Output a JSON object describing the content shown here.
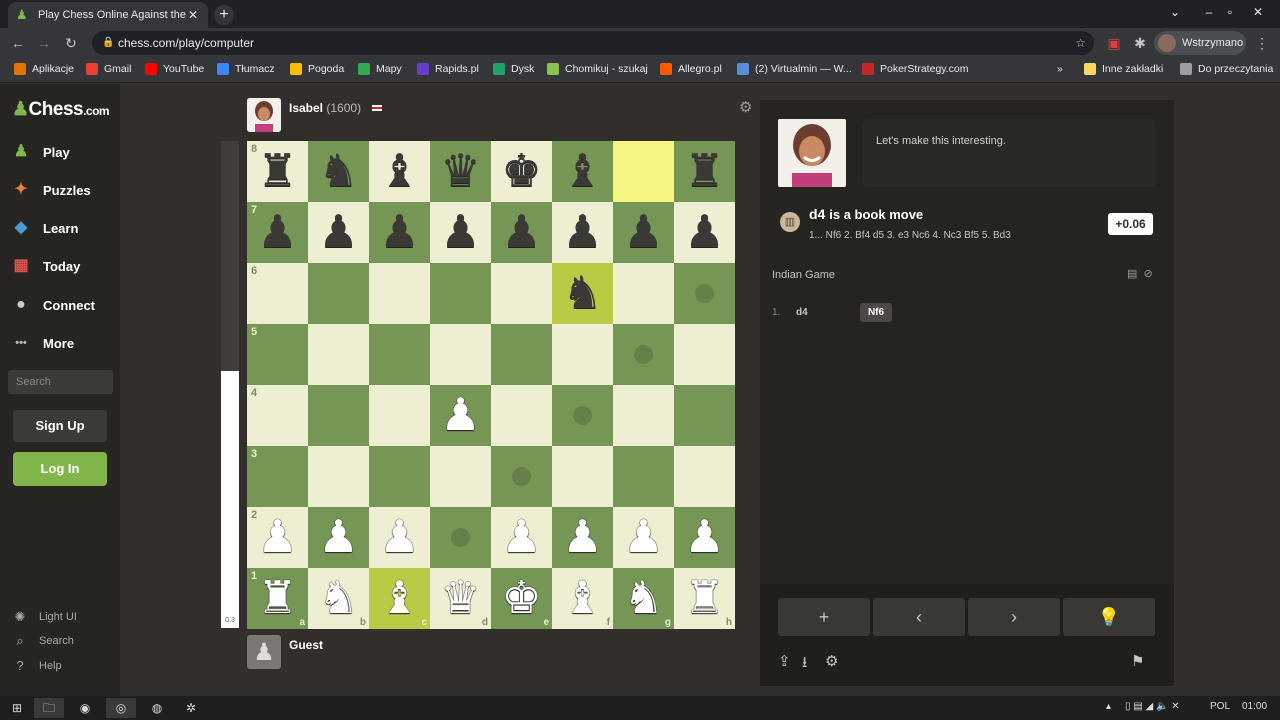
{
  "browser": {
    "tab_title": "Play Chess Online Against the Co",
    "url": "chess.com/play/computer",
    "profile_label": "Wstrzymano",
    "bookmarks": [
      {
        "label": "Aplikacje",
        "color": "#e37400"
      },
      {
        "label": "Gmail",
        "color": "#ea4335"
      },
      {
        "label": "YouTube",
        "color": "#ff0000"
      },
      {
        "label": "Tłumacz",
        "color": "#4285f4"
      },
      {
        "label": "Pogoda",
        "color": "#fbbc04"
      },
      {
        "label": "Mapy",
        "color": "#34a853"
      },
      {
        "label": "Rapids.pl",
        "color": "#6a3ec7"
      },
      {
        "label": "Dysk",
        "color": "#1fa463"
      },
      {
        "label": "Chomikuj - szukaj",
        "color": "#8bc34a"
      },
      {
        "label": "Allegro.pl",
        "color": "#ff5a00"
      },
      {
        "label": "(2) Virtualmin — W...",
        "color": "#5b8dd6"
      },
      {
        "label": "PokerStrategy.com",
        "color": "#c62828"
      },
      {
        "label": "Inne zakładki",
        "color": "#f9d65c"
      },
      {
        "label": "Do przeczytania",
        "color": "#9e9e9e"
      }
    ]
  },
  "sidebar": {
    "logo_main": "Chess",
    "logo_suffix": ".com",
    "items": [
      {
        "label": "Play",
        "icon": "hand-pawn-icon"
      },
      {
        "label": "Puzzles",
        "icon": "puzzle-icon"
      },
      {
        "label": "Learn",
        "icon": "learn-icon"
      },
      {
        "label": "Today",
        "icon": "news-icon"
      },
      {
        "label": "Connect",
        "icon": "chat-icon"
      },
      {
        "label": "More",
        "icon": "more-icon"
      }
    ],
    "search_placeholder": "Search",
    "signup_label": "Sign Up",
    "login_label": "Log In",
    "footer": [
      {
        "label": "Light UI",
        "icon": "sun-icon"
      },
      {
        "label": "Search",
        "icon": "search-icon"
      },
      {
        "label": "Help",
        "icon": "help-icon"
      }
    ]
  },
  "game": {
    "opponent_name": "Isabel",
    "opponent_rating": "(1600)",
    "player_name": "Guest",
    "eval_bar_value": "0.3",
    "board": [
      [
        "r",
        "n",
        "b",
        "q",
        "k",
        "b",
        "",
        "r"
      ],
      [
        "p",
        "p",
        "p",
        "p",
        "p",
        "p",
        "p",
        "p"
      ],
      [
        "",
        "",
        "",
        "",
        "",
        "n",
        "",
        ""
      ],
      [
        "",
        "",
        "",
        "",
        "",
        "",
        "",
        ""
      ],
      [
        "",
        "",
        "",
        "P",
        "",
        "",
        "",
        ""
      ],
      [
        "",
        "",
        "",
        "",
        "",
        "",
        "",
        ""
      ],
      [
        "P",
        "P",
        "P",
        "",
        "P",
        "P",
        "P",
        "P"
      ],
      [
        "R",
        "N",
        "B",
        "Q",
        "K",
        "B",
        "N",
        "R"
      ]
    ],
    "highlights": [
      {
        "r": 0,
        "c": 6
      },
      {
        "r": 2,
        "c": 5
      },
      {
        "r": 7,
        "c": 2
      }
    ],
    "hints": [
      {
        "r": 2,
        "c": 7
      },
      {
        "r": 3,
        "c": 6
      },
      {
        "r": 4,
        "c": 5
      },
      {
        "r": 5,
        "c": 4
      },
      {
        "r": 6,
        "c": 3
      }
    ],
    "files": [
      "a",
      "b",
      "c",
      "d",
      "e",
      "f",
      "g",
      "h"
    ],
    "ranks": [
      "8",
      "7",
      "6",
      "5",
      "4",
      "3",
      "2",
      "1"
    ]
  },
  "panel": {
    "bot_message": "Let's make this interesting.",
    "book_move": "d4",
    "book_text": "is a book move",
    "book_line": "1... Nf6 2. Bf4 d5 3. e3 Nc6 4. Nc3 Bf5 5. Bd3",
    "eval": "+0.06",
    "opening": "Indian Game",
    "moves": [
      {
        "num": "1.",
        "white": "d4",
        "black": "Nf6"
      }
    ]
  },
  "taskbar": {
    "lang": "POL",
    "time": "01:00"
  }
}
